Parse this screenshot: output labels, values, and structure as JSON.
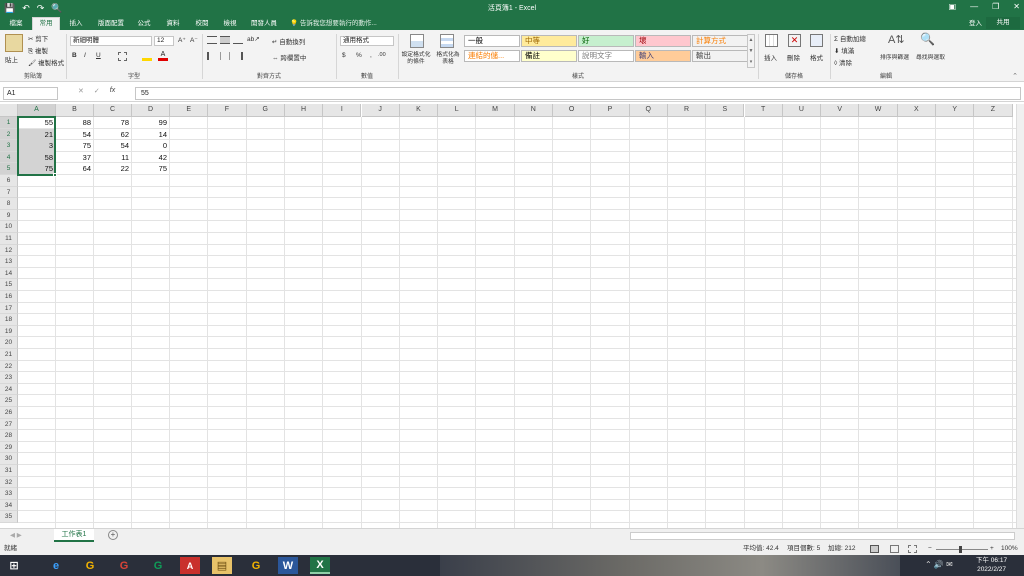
{
  "app": {
    "title": "活頁簿1 - Excel",
    "quick_access": [
      "💾",
      "↶",
      "↷",
      "🔍"
    ],
    "window_controls": [
      "▣",
      "—",
      "❐",
      "✕"
    ]
  },
  "tabs": [
    "檔案",
    "常用",
    "插入",
    "版面配置",
    "公式",
    "資料",
    "校閱",
    "檢視",
    "開發人員"
  ],
  "tell_me": "告訴我您想要執行的動作...",
  "login": "登入",
  "share": "共用",
  "ribbon": {
    "clipboard": {
      "paste": "貼上",
      "cut": "剪下",
      "copy": "複製",
      "format_painter": "複製格式",
      "label": "剪貼簿"
    },
    "font": {
      "name": "新細明體",
      "size": "12",
      "grow": "A⁺",
      "shrink": "A⁻",
      "bold": "B",
      "italic": "I",
      "underline": "U",
      "label": "字型"
    },
    "alignment": {
      "wrap": "自動換列",
      "merge": "跨欄置中",
      "label": "對齊方式"
    },
    "number": {
      "format": "通用格式",
      "currency": "$",
      "percent": "%",
      "comma": ",",
      "label": "數值"
    },
    "styles": {
      "conditional": "設定格式化的條件",
      "table": "格式化為表格",
      "items": [
        {
          "label": "一般",
          "bg": "#ffffff",
          "fg": "#000000"
        },
        {
          "label": "中等",
          "bg": "#ffeb9c",
          "fg": "#9c6500"
        },
        {
          "label": "好",
          "bg": "#c6efce",
          "fg": "#006100"
        },
        {
          "label": "壞",
          "bg": "#ffc7ce",
          "fg": "#9c0006"
        },
        {
          "label": "計算方式",
          "bg": "#f2f2f2",
          "fg": "#fa7d00"
        },
        {
          "label": "連結的儲...",
          "bg": "#ffffff",
          "fg": "#fa7d00"
        },
        {
          "label": "備註",
          "bg": "#ffffcc",
          "fg": "#000000"
        },
        {
          "label": "說明文字",
          "bg": "#ffffff",
          "fg": "#7f7f7f"
        },
        {
          "label": "輸入",
          "bg": "#ffcc99",
          "fg": "#3f3f76"
        },
        {
          "label": "輸出",
          "bg": "#f2f2f2",
          "fg": "#3f3f3f"
        }
      ],
      "label": "樣式"
    },
    "cells": {
      "insert": "插入",
      "delete": "刪除",
      "format": "格式",
      "label": "儲存格"
    },
    "editing": {
      "autosum": "自動加總",
      "fill": "填滿",
      "clear": "清除",
      "sort": "排序與篩選",
      "find": "尋找與選取",
      "label": "編輯"
    }
  },
  "formula_bar": {
    "name_box": "A1",
    "value": "55",
    "fx": "fx"
  },
  "columns": [
    "A",
    "B",
    "C",
    "D",
    "E",
    "F",
    "G",
    "H",
    "I",
    "J",
    "K",
    "L",
    "M",
    "N",
    "O",
    "P",
    "Q",
    "R",
    "S",
    "T",
    "U",
    "V",
    "W",
    "X",
    "Y",
    "Z"
  ],
  "row_count": 35,
  "cells": [
    [
      55,
      88,
      78,
      99
    ],
    [
      21,
      54,
      62,
      14
    ],
    [
      3,
      75,
      54,
      0
    ],
    [
      58,
      37,
      11,
      42
    ],
    [
      75,
      64,
      22,
      75
    ]
  ],
  "sheet": {
    "name": "工作表1",
    "add": "+"
  },
  "status": {
    "ready": "就緒",
    "average": "平均值: 42.4",
    "count": "項目個數: 5",
    "sum": "加總: 212",
    "zoom": "100%"
  },
  "taskbar": {
    "time": "下午 06:17",
    "date": "2022/2/27",
    "apps": [
      "e",
      "G",
      "G",
      "G",
      "A",
      "▤",
      "G",
      "W",
      "X"
    ]
  }
}
